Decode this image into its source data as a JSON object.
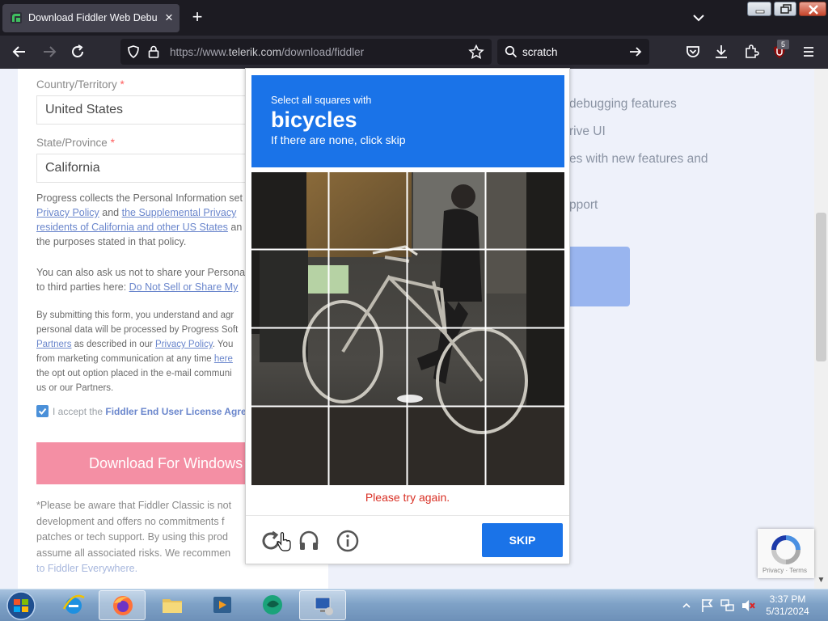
{
  "browser": {
    "tab_title": "Download Fiddler Web Debugging Proxy",
    "url_prefix": "https://www.",
    "url_domain": "telerik.com",
    "url_path": "/download/fiddler",
    "search_text": "scratch",
    "extension_badge": "5"
  },
  "form": {
    "country_label": "Country/Territory",
    "required_mark": "*",
    "country_value": "United States",
    "state_label": "State/Province",
    "state_value": "California",
    "privacy_para": {
      "line1": "Progress collects the Personal Information set",
      "link1": "Privacy Policy",
      "and": " and ",
      "link2": "the Supplemental Privacy",
      "link3": "residents of California and other US States",
      "line3_tail": " an",
      "line4": "the purposes stated in that policy."
    },
    "share_para": {
      "line1": "You can also ask us not to share your Persona",
      "line2_pre": "to third parties here: ",
      "link": "Do Not Sell or Share My"
    },
    "submit_para": {
      "line1": "By submitting this form, you understand and agr",
      "line2": "personal data will be processed by Progress Soft",
      "link_partners": "Partners",
      "line3_mid": " as described in our ",
      "link_privacy": "Privacy Policy",
      "line3_tail": ". You",
      "line4_pre": "from marketing communication at any time ",
      "link_here": "here",
      "line5": "the opt out option placed in the e-mail communi",
      "line6": "us or our Partners."
    },
    "accept_pre": "I accept the ",
    "accept_link": "Fiddler End User License Agree",
    "download_button": "Download For Windows",
    "disclaimer": {
      "l1": "*Please be aware that Fiddler Classic is not",
      "l2": "development and offers no commitments f",
      "l3": "patches or tech support. By using this prod",
      "l4": "assume all associated risks. We recommen",
      "l5": "to Fiddler Everywhere."
    }
  },
  "features": {
    "f1": "debugging features",
    "f2": "rive UI",
    "f3": "es with new features and",
    "f4": "pport"
  },
  "recaptcha_badge": {
    "terms": "Privacy · Terms"
  },
  "captcha": {
    "instruction": "Select all squares with",
    "target": "bicycles",
    "hint": "If there are none, click skip",
    "error": "Please try again.",
    "skip_button": "SKIP"
  },
  "taskbar": {
    "time": "3:37 PM",
    "date": "5/31/2024"
  },
  "colors": {
    "captcha_blue": "#1a73e8",
    "error_red": "#d93025",
    "download_pink": "#f48fa4",
    "link_blue": "#6a86cc"
  }
}
